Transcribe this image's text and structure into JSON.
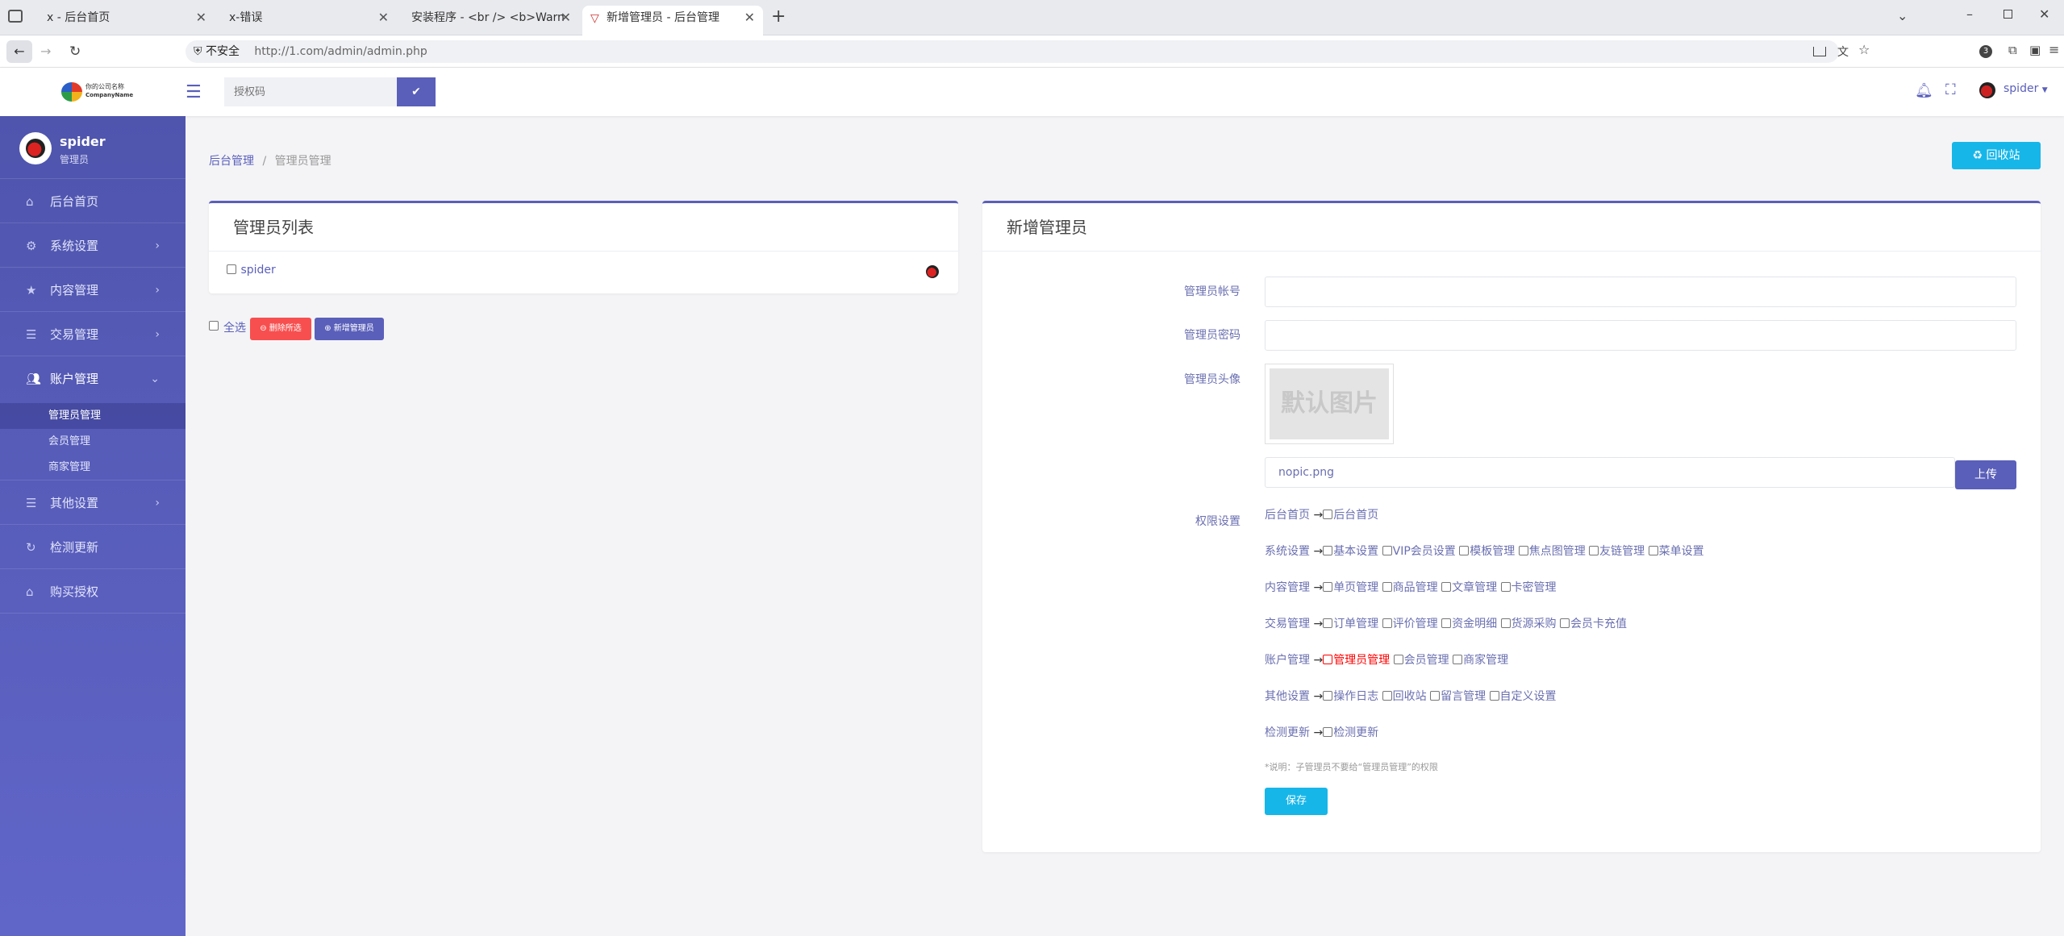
{
  "browser": {
    "tabs": [
      {
        "label": "x - 后台首页"
      },
      {
        "label": "x-错误"
      },
      {
        "label": "安装程序 - <br /> <b>Warning</b>:"
      },
      {
        "label": "新增管理员 - 后台管理"
      }
    ],
    "security_label": "不安全",
    "url": "http://1.com/admin/admin.php",
    "extension_badge": "3"
  },
  "header": {
    "logo_line1": "你的公司名称",
    "logo_line2": "CompanyName",
    "auth_placeholder": "授权码",
    "user_name": "spider"
  },
  "sidebar": {
    "user_name": "spider",
    "user_role": "管理员",
    "items": [
      {
        "label": "后台首页",
        "icon": "home-icon",
        "expandable": false
      },
      {
        "label": "系统设置",
        "icon": "gear-icon",
        "expandable": true
      },
      {
        "label": "内容管理",
        "icon": "star-icon",
        "expandable": true
      },
      {
        "label": "交易管理",
        "icon": "list-icon",
        "expandable": true
      },
      {
        "label": "账户管理",
        "icon": "users-icon",
        "expandable": true
      },
      {
        "label": "其他设置",
        "icon": "list-icon",
        "expandable": true
      },
      {
        "label": "检测更新",
        "icon": "refresh-icon",
        "expandable": false
      },
      {
        "label": "购买授权",
        "icon": "home-icon",
        "expandable": false
      }
    ],
    "sub_items": [
      "管理员管理",
      "会员管理",
      "商家管理"
    ]
  },
  "breadcrumb": {
    "root": "后台管理",
    "current": "管理员管理"
  },
  "recycle_button": "回收站",
  "admin_list": {
    "title": "管理员列表",
    "rows": [
      {
        "name": "spider"
      }
    ],
    "select_all": "全选",
    "delete_selected": "删除所选",
    "add_admin": "新增管理员"
  },
  "form": {
    "title": "新增管理员",
    "account_label": "管理员帐号",
    "password_label": "管理员密码",
    "avatar_label": "管理员头像",
    "avatar_placeholder_text": "默认图片",
    "avatar_filename": "nopic.png",
    "upload_button": "上传",
    "permissions_label": "权限设置",
    "permissions": [
      {
        "group": "后台首页",
        "items": [
          "后台首页"
        ]
      },
      {
        "group": "系统设置",
        "items": [
          "基本设置",
          "VIP会员设置",
          "模板管理",
          "焦点图管理",
          "友链管理",
          "菜单设置"
        ]
      },
      {
        "group": "内容管理",
        "items": [
          "单页管理",
          "商品管理",
          "文章管理",
          "卡密管理"
        ]
      },
      {
        "group": "交易管理",
        "items": [
          "订单管理",
          "评价管理",
          "资金明细",
          "货源采购",
          "会员卡充值"
        ]
      },
      {
        "group": "账户管理",
        "items": [
          "管理员管理",
          "会员管理",
          "商家管理"
        ]
      },
      {
        "group": "其他设置",
        "items": [
          "操作日志",
          "回收站",
          "留言管理",
          "自定义设置"
        ]
      },
      {
        "group": "检测更新",
        "items": [
          "检测更新"
        ]
      }
    ],
    "note": "*说明：子管理员不要给“管理员管理”的权限",
    "save_button": "保存"
  },
  "colors": {
    "accent": "#5a5fba",
    "cyan": "#17b6e9",
    "danger": "#f74f4f",
    "highlight": "#ff0000"
  }
}
